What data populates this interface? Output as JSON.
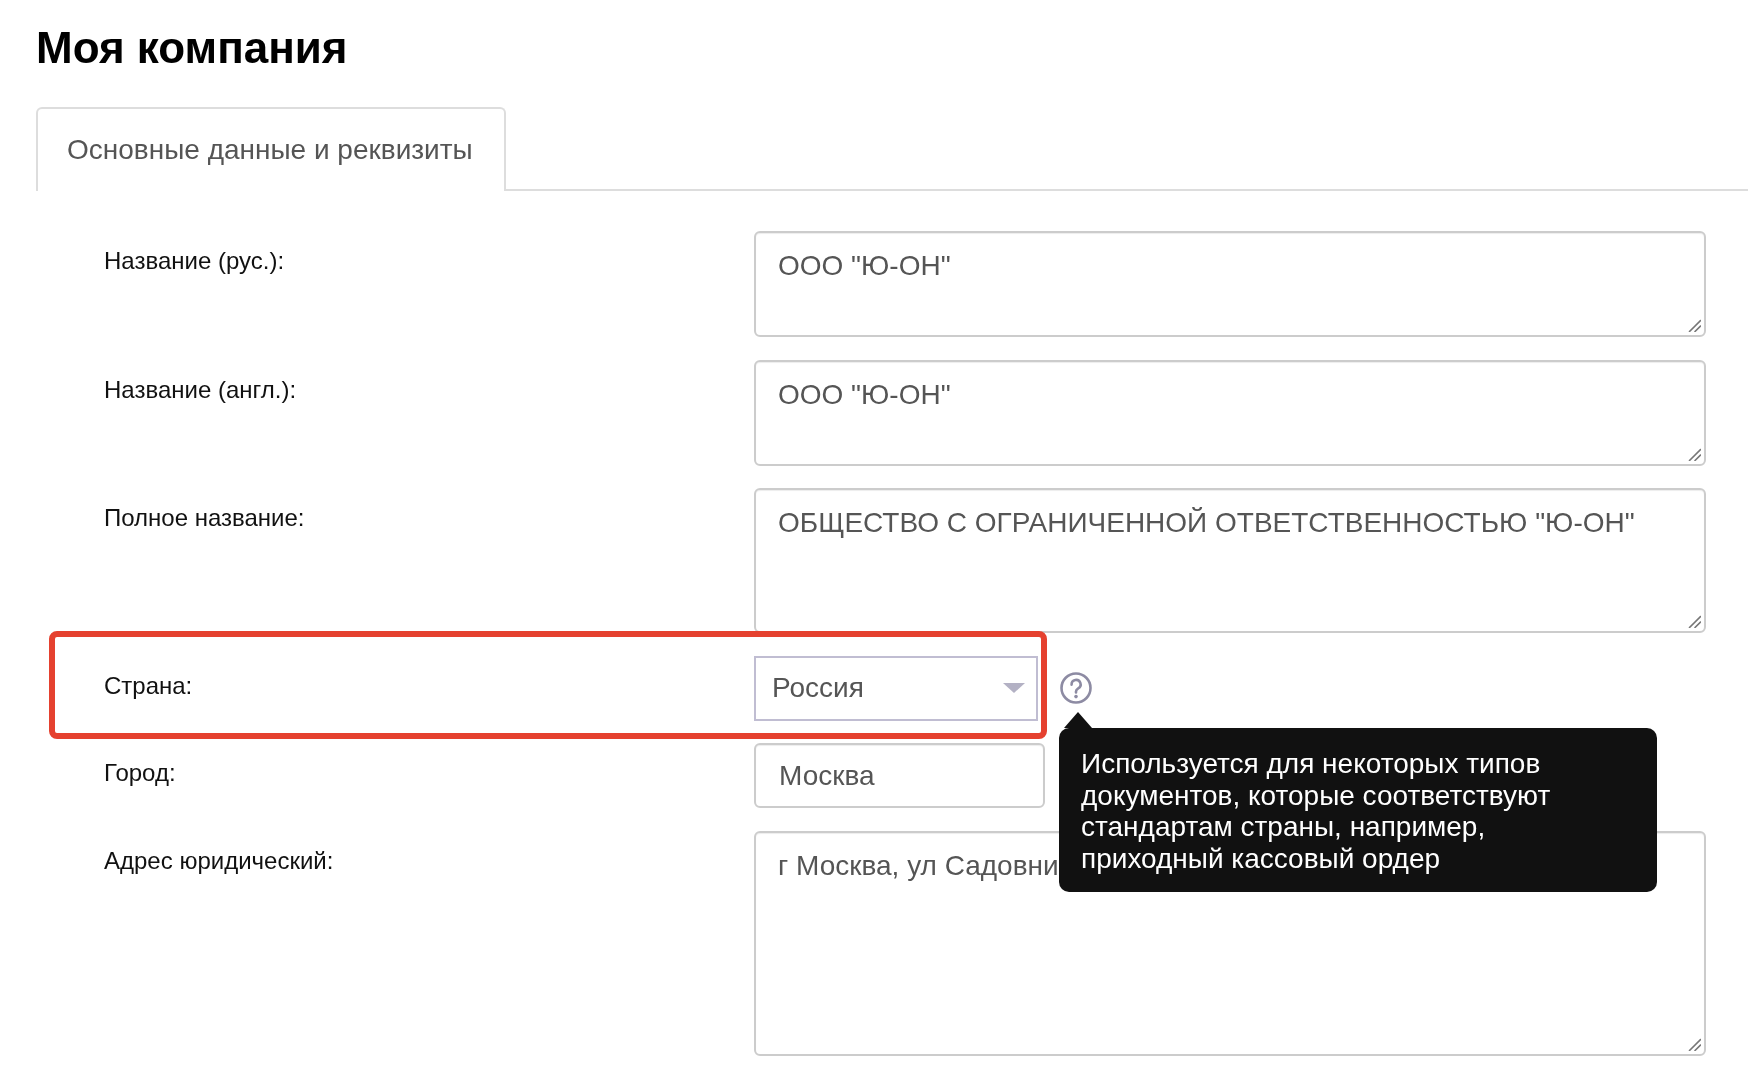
{
  "page": {
    "title": "Моя компания"
  },
  "tabs": [
    {
      "label": "Основные данные и реквизиты",
      "selected": true
    }
  ],
  "fields": [
    {
      "kind": "textarea",
      "label": "Название (рус.):",
      "value": "ООО \"Ю-ОН\"",
      "highlighted": false
    },
    {
      "kind": "textarea",
      "label": "Название (англ.):",
      "value": "ООО \"Ю-ОН\"",
      "highlighted": false
    },
    {
      "kind": "textarea",
      "label": "Полное название:",
      "value": "ОБЩЕСТВО С ОГРАНИЧЕННОЙ ОТВЕТСТВЕННОСТЬЮ \"Ю-ОН\"",
      "highlighted": false
    },
    {
      "kind": "select",
      "label": "Страна:",
      "value": "Россия",
      "highlighted": true,
      "help": {
        "open": true,
        "tooltip": "Используется для некоторых типов документов, которые соответствуют стандартам страны, например, приходный кассовый ордер"
      }
    },
    {
      "kind": "input",
      "label": "Город:",
      "value": "Москва",
      "highlighted": false
    },
    {
      "kind": "textarea",
      "label": "Адрес юридический:",
      "value": "г Москва, ул Садовни",
      "highlighted": false
    }
  ]
}
